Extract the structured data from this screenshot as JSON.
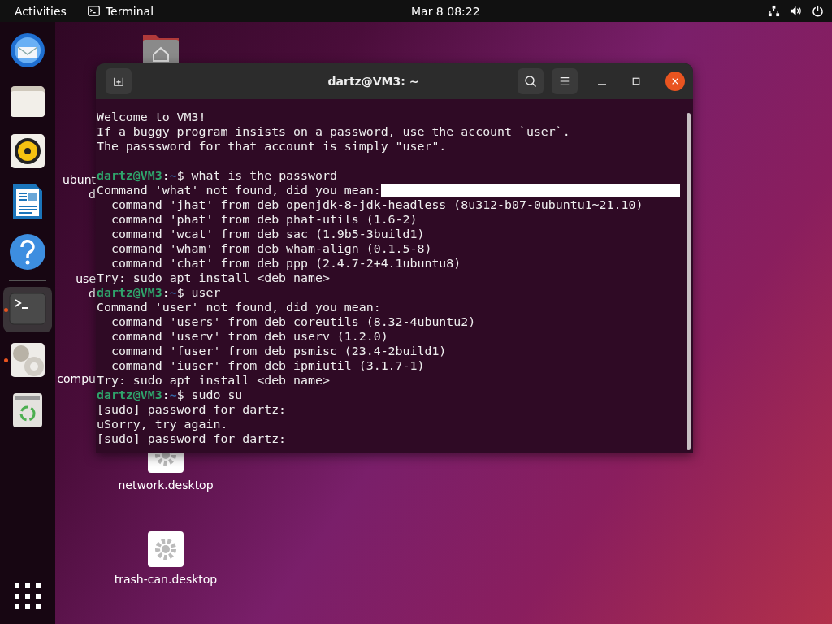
{
  "top_bar": {
    "activities": "Activities",
    "app_name": "Terminal",
    "clock": "Mar 8  08:22"
  },
  "dock": {
    "items": [
      {
        "kind": "thunderbird",
        "running": false,
        "selected": false
      },
      {
        "kind": "files",
        "running": false,
        "selected": false
      },
      {
        "kind": "rhythmbox",
        "running": false,
        "selected": false
      },
      {
        "kind": "writer",
        "running": false,
        "selected": false
      },
      {
        "kind": "help",
        "running": false,
        "selected": false
      },
      {
        "kind": "separator"
      },
      {
        "kind": "terminal",
        "running": true,
        "selected": true
      },
      {
        "kind": "settings",
        "running": true,
        "selected": false
      },
      {
        "kind": "trash",
        "running": false,
        "selected": false
      },
      {
        "kind": "apps",
        "running": false,
        "selected": false
      }
    ]
  },
  "desktop_icons": [
    {
      "kind": "home"
    },
    {
      "kind": "hidden",
      "label_lines": [
        "ubunt",
        "d"
      ]
    },
    {
      "kind": "hidden",
      "label_lines": [
        "use",
        "d"
      ]
    },
    {
      "kind": "hidden",
      "label_lines": [
        "compu"
      ]
    },
    {
      "kind": "gear",
      "label_lines": [
        "network.desktop"
      ]
    },
    {
      "kind": "gear",
      "label_lines": [
        "trash-can.desktop"
      ]
    }
  ],
  "terminal": {
    "title": "dartz@VM3: ~",
    "lines": [
      {
        "kind": "output",
        "text": "Welcome to VM3!"
      },
      {
        "kind": "output",
        "text": "If a buggy program insists on a password, use the account `user`."
      },
      {
        "kind": "output",
        "text": "The passsword for that account is simply \"user\"."
      },
      {
        "kind": "blank"
      },
      {
        "kind": "prompt",
        "host": "dartz@VM3",
        "colon": ":",
        "path": "~",
        "command": "$ what is the password"
      },
      {
        "kind": "output",
        "text": "Command 'what' not found, did you mean:",
        "highlight": true
      },
      {
        "kind": "output",
        "text": "  command 'jhat' from deb openjdk-8-jdk-headless (8u312-b07-0ubuntu1~21.10)"
      },
      {
        "kind": "output",
        "text": "  command 'phat' from deb phat-utils (1.6-2)"
      },
      {
        "kind": "output",
        "text": "  command 'wcat' from deb sac (1.9b5-3build1)"
      },
      {
        "kind": "output",
        "text": "  command 'wham' from deb wham-align (0.1.5-8)"
      },
      {
        "kind": "output",
        "text": "  command 'chat' from deb ppp (2.4.7-2+4.1ubuntu8)"
      },
      {
        "kind": "output",
        "text": "Try: sudo apt install <deb name>"
      },
      {
        "kind": "prompt",
        "host": "dartz@VM3",
        "colon": ":",
        "path": "~",
        "command": "$ user"
      },
      {
        "kind": "output",
        "text": "Command 'user' not found, did you mean:"
      },
      {
        "kind": "output",
        "text": "  command 'users' from deb coreutils (8.32-4ubuntu2)"
      },
      {
        "kind": "output",
        "text": "  command 'userv' from deb userv (1.2.0)"
      },
      {
        "kind": "output",
        "text": "  command 'fuser' from deb psmisc (23.4-2build1)"
      },
      {
        "kind": "output",
        "text": "  command 'iuser' from deb ipmiutil (3.1.7-1)"
      },
      {
        "kind": "output",
        "text": "Try: sudo apt install <deb name>"
      },
      {
        "kind": "prompt",
        "host": "dartz@VM3",
        "colon": ":",
        "path": "~",
        "command": "$ sudo su"
      },
      {
        "kind": "output",
        "text": "[sudo] password for dartz:"
      },
      {
        "kind": "output",
        "text": "uSorry, try again."
      },
      {
        "kind": "output",
        "text": "[sudo] password for dartz:"
      }
    ]
  }
}
